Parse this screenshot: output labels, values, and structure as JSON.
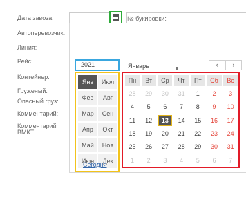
{
  "form": {
    "labels": [
      "Дата завоза:",
      "Автоперевозчик:",
      "Линия:",
      "Рейс:",
      "Контейнер:",
      "Груженый:",
      "Опасный груз:",
      "Комментарий:",
      "Комментарий",
      "ВМКТ:"
    ],
    "booking_label": "№ букировки:"
  },
  "calendar": {
    "year": "2021",
    "month_label": "Январь",
    "prev_label": "‹",
    "next_label": "›",
    "months": [
      "Янв",
      "Июл",
      "Фев",
      "Авг",
      "Мар",
      "Сен",
      "Апр",
      "Окт",
      "Май",
      "Ноя",
      "Июн",
      "Дек"
    ],
    "selected_month": "Янв",
    "today_label": "Сегодня",
    "weekdays": [
      "Пн",
      "Вт",
      "Ср",
      "Чт",
      "Пт",
      "Сб",
      "Вс"
    ],
    "weeks": [
      [
        "28",
        "29",
        "30",
        "31",
        "1",
        "2",
        "3"
      ],
      [
        "4",
        "5",
        "6",
        "7",
        "8",
        "9",
        "10"
      ],
      [
        "11",
        "12",
        "13",
        "14",
        "15",
        "16",
        "17"
      ],
      [
        "18",
        "19",
        "20",
        "21",
        "22",
        "23",
        "24"
      ],
      [
        "25",
        "26",
        "27",
        "28",
        "29",
        "30",
        "31"
      ],
      [
        "1",
        "2",
        "3",
        "4",
        "5",
        "6",
        "7"
      ]
    ],
    "today": "13",
    "colors": {
      "year_highlight": "#3aa7df",
      "months_highlight": "#f2c31c",
      "days_highlight": "#e21b28",
      "button_highlight": "#2fab3a",
      "weekend": "#e4453a"
    }
  }
}
